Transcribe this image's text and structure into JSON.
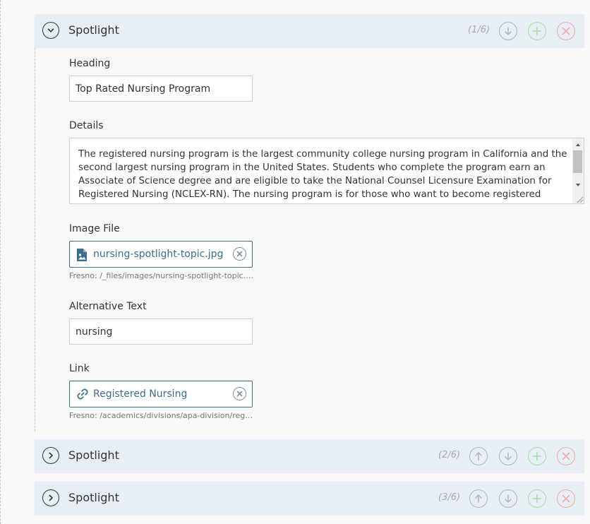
{
  "groups": [
    {
      "title": "Spotlight",
      "count": "(1/6)",
      "expanded": true
    },
    {
      "title": "Spotlight",
      "count": "(2/6)",
      "expanded": false
    },
    {
      "title": "Spotlight",
      "count": "(3/6)",
      "expanded": false
    }
  ],
  "form": {
    "heading": {
      "label": "Heading",
      "value": "Top Rated Nursing Program"
    },
    "details": {
      "label": "Details",
      "value": "The registered nursing program is the largest community college nursing program in California and the second largest nursing program in the United States.  Students who complete the program earn an Associate of Science degree and are eligible to take the National Counsel Licensure Examination for Registered Nursing (NCLEX-RN).  The nursing program is for those who want to become registered nurses"
    },
    "image_file": {
      "label": "Image File",
      "value": "nursing-spotlight-topic.jpg",
      "path": "Fresno: /_files/images/nursing-spotlight-topic.jpg"
    },
    "alt_text": {
      "label": "Alternative Text",
      "value": "nursing"
    },
    "link": {
      "label": "Link",
      "value": "Registered Nursing",
      "path": "Fresno: /academics/divisions/apa-division/registered-nursing"
    }
  },
  "icons": {
    "toggle_expanded": "chevron-down-icon",
    "toggle_collapsed": "chevron-right-icon",
    "move_up": "arrow-up-icon",
    "move_down": "arrow-down-icon",
    "add": "plus-icon",
    "remove": "close-icon",
    "file": "image-file-icon",
    "link": "link-icon",
    "clear": "clear-icon"
  },
  "colors": {
    "header_bg": "#e8eef5",
    "accent": "#3e6d8e",
    "add_green": "#a8dba8",
    "remove_red": "#f0a8a8",
    "control_gray": "#b4b4b4"
  }
}
